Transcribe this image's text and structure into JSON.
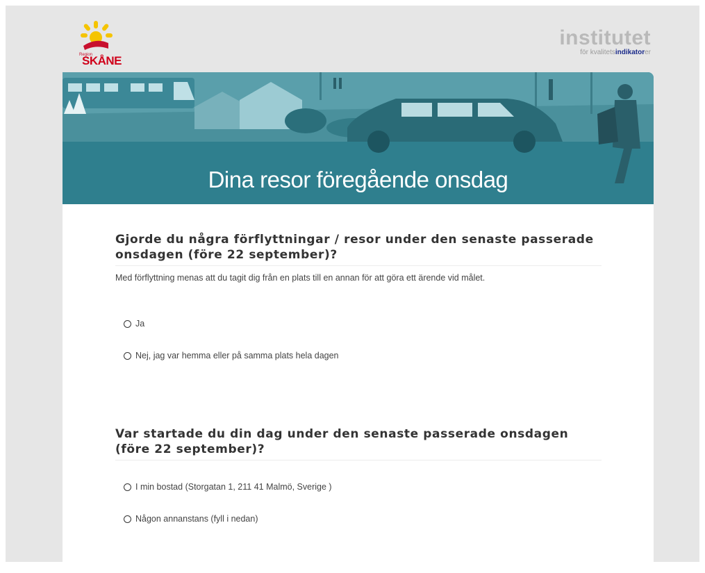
{
  "logos": {
    "skane_small": "Region",
    "skane_word": "SKÅNE",
    "institutet_word": "institutet",
    "institutet_sub_prefix": "för kvalitets",
    "institutet_sub_bold": "indikator",
    "institutet_sub_suffix": "er"
  },
  "banner": {
    "title": "Dina resor föregående onsdag"
  },
  "questions": [
    {
      "title": "Gjorde du några förflyttningar / resor under den senaste passerade onsdagen (före 22 september)?",
      "description": "Med förflyttning menas att du tagit dig från en plats till en annan för att göra ett ärende vid målet.",
      "options": [
        {
          "label": "Ja"
        },
        {
          "label": "Nej, jag var hemma eller på samma plats hela dagen"
        }
      ]
    },
    {
      "title": "Var startade du din dag under den senaste passerade onsdagen (före 22 september)?",
      "options": [
        {
          "label": "I min bostad (Storgatan 1, 211 41 Malmö, Sverige )"
        },
        {
          "label": "Någon annanstans (fyll i nedan)"
        }
      ]
    }
  ],
  "colors": {
    "banner_teal": "#2f7f8e",
    "brand_red": "#d0021b",
    "brand_yellow": "#f5c400"
  }
}
